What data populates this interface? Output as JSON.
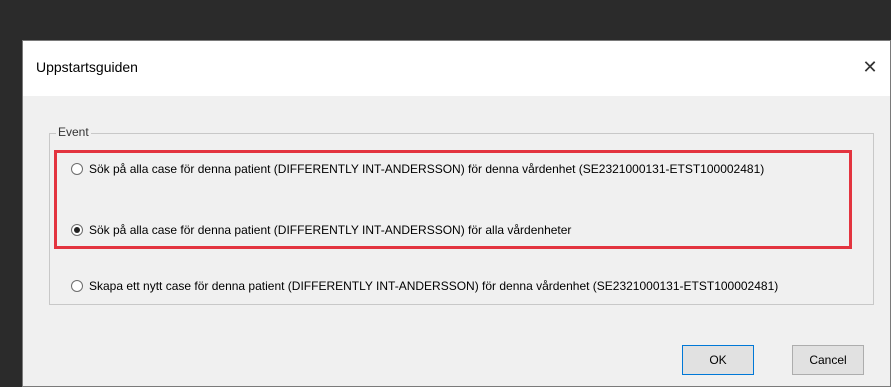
{
  "dialog": {
    "title": "Uppstartsguiden",
    "close_symbol": "✕",
    "group": {
      "label": "Event",
      "options": [
        {
          "label": "Sök på alla case för denna patient (DIFFERENTLY INT-ANDERSSON) för denna vårdenhet (SE2321000131-ETST100002481)",
          "selected": false
        },
        {
          "label": "Sök på alla case för denna patient (DIFFERENTLY INT-ANDERSSON) för alla vårdenheter",
          "selected": true
        },
        {
          "label": "Skapa ett nytt case för denna patient (DIFFERENTLY INT-ANDERSSON) för denna vårdenhet (SE2321000131-ETST100002481)",
          "selected": false
        }
      ]
    },
    "buttons": {
      "ok_label": "OK",
      "cancel_label": "Cancel"
    },
    "highlight_color": "#e3343f"
  }
}
